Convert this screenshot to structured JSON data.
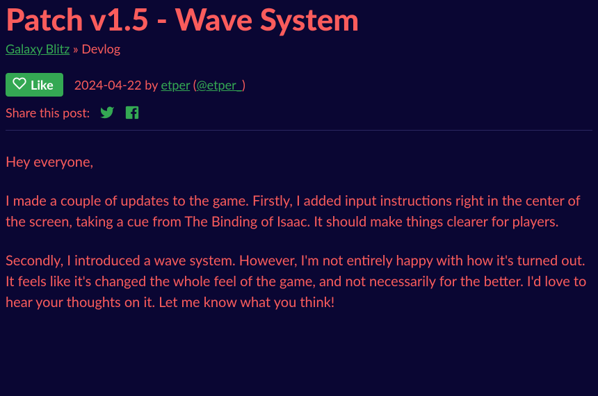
{
  "title": "Patch v1.5 - Wave System",
  "breadcrumb": {
    "game_link": "Galaxy Blitz",
    "sep": "»",
    "tail": "Devlog"
  },
  "like_label": "Like",
  "byline": {
    "date": "2024-04-22",
    "by": "by",
    "author": "etper",
    "handle_open": "(",
    "handle": "@etper_",
    "handle_close": ")"
  },
  "share_label": "Share this post:",
  "body": {
    "p1": "Hey everyone,",
    "p2": "I made a couple of updates to the game. Firstly, I added input instructions right in the center of the screen, taking a cue from The Binding of Isaac. It should make things clearer for players.",
    "p3": "Secondly, I introduced a wave system. However, I'm not entirely happy with how it's turned out. It feels like it's changed the whole feel of the game, and not necessarily for the better. I'd love to hear your thoughts on it. Let me know what you think!"
  }
}
